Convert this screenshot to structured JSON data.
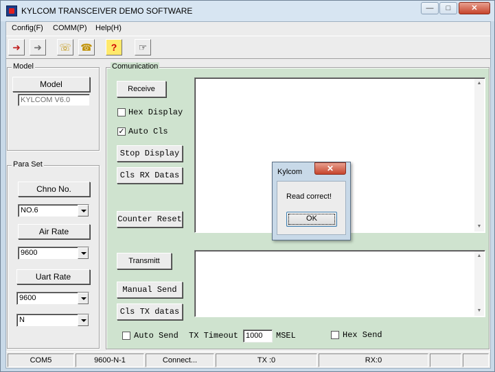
{
  "window": {
    "title": "KYLCOM TRANSCEIVER DEMO SOFTWARE"
  },
  "menu": [
    "Config(F)",
    "COMM(P)",
    "Help(H)"
  ],
  "toolbar_icons": [
    "import-icon",
    "export-icon",
    "phone-connect-icon",
    "phone-disconnect-icon",
    "help-icon",
    "hand-pointer-icon"
  ],
  "model_group": {
    "title": "Model",
    "button": "Model",
    "value": "KYLCOM V6.0"
  },
  "para_group": {
    "title": "Para Set",
    "chno_button": "Chno No.",
    "chno_value": "NO.6",
    "air_button": "Air Rate",
    "air_value": "9600",
    "uart_button": "Uart Rate",
    "uart_value": "9600",
    "parity_value": "N"
  },
  "comm_group": {
    "title": "Comunication",
    "receive_label": "Receive",
    "hex_display": {
      "label": "Hex Display",
      "checked": false
    },
    "auto_cls": {
      "label": "Auto Cls",
      "checked": true
    },
    "stop_display": "Stop Display",
    "cls_rx": "Cls RX Datas",
    "counter_reset": "Counter Reset",
    "transmit_label": "Transmitt",
    "manual_send": "Manual Send",
    "cls_tx": "Cls TX datas",
    "auto_send": {
      "label": "Auto Send",
      "checked": false
    },
    "tx_timeout_label": "TX Timeout",
    "tx_timeout_value": "1000",
    "msel_label": "MSEL",
    "hex_send": {
      "label": "Hex Send",
      "checked": false
    }
  },
  "statusbar": [
    "COM5",
    "9600-N-1",
    "Connect...",
    "TX :0",
    "RX:0",
    "",
    ""
  ],
  "dialog": {
    "title": "Kylcom",
    "message": "Read correct!",
    "ok": "OK"
  }
}
